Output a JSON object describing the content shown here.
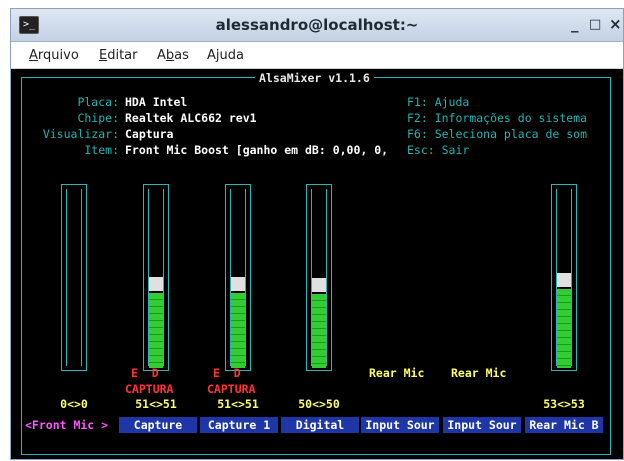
{
  "window": {
    "title": "alessandro@localhost:~",
    "minimize": "_",
    "maximize": "□",
    "close": "×"
  },
  "menubar": {
    "items": [
      "Arquivo",
      "Editar",
      "Abas",
      "Ajuda"
    ]
  },
  "mixer": {
    "title": "AlsaMixer v1.1.6",
    "info": [
      {
        "label": "Placa:",
        "value": "HDA Intel"
      },
      {
        "label": "Chipe:",
        "value": "Realtek ALC662 rev1"
      },
      {
        "label": "Visualizar:",
        "value": "Captura"
      },
      {
        "label": "Item:",
        "value": "Front Mic Boost [ganho em dB: 0,00, 0,"
      }
    ],
    "help": [
      "F1: Ajuda",
      "F2: Informações do sistema",
      "F6: Seleciona placa de som",
      "Esc: Sair"
    ],
    "controls": [
      {
        "name": "<Front Mic >",
        "level": 0,
        "volume": "0<>0",
        "selected": true
      },
      {
        "name": "Capture",
        "level": 0.51,
        "volume": "51<>51",
        "capture": "CAPTURA",
        "ed": "E  D"
      },
      {
        "name": "Capture 1",
        "level": 0.51,
        "volume": "51<>51",
        "capture": "CAPTURA",
        "ed": "E  D"
      },
      {
        "name": "Digital",
        "level": 0.5,
        "volume": "50<>50"
      },
      {
        "name": "Input Sour",
        "option": "Rear Mic"
      },
      {
        "name": "Input Sour",
        "option": "Rear Mic"
      },
      {
        "name": "Rear Mic B",
        "level": 0.53,
        "volume": "53<>53"
      }
    ]
  }
}
